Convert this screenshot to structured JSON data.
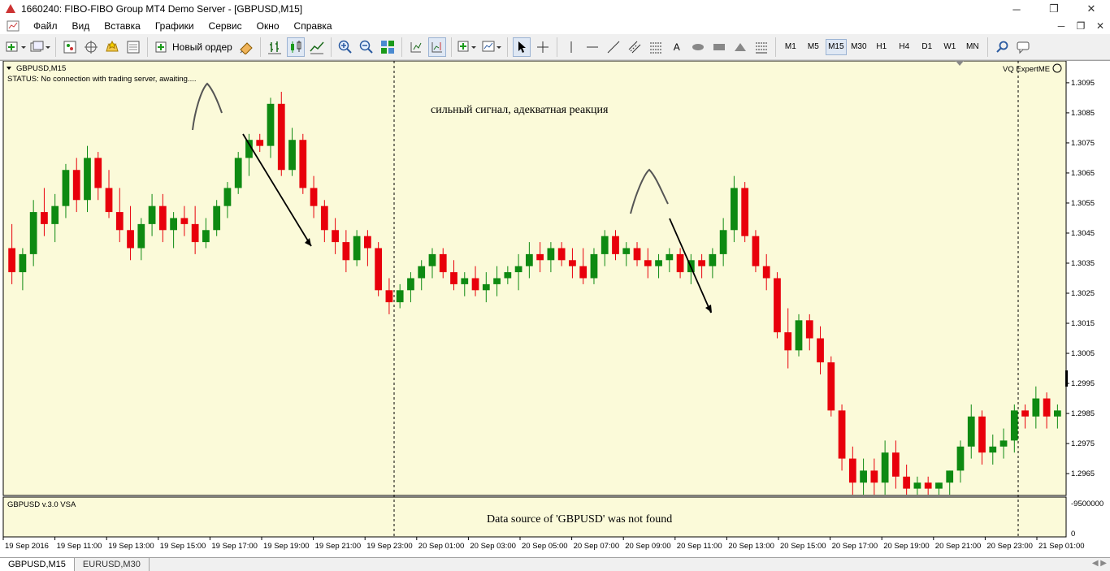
{
  "window": {
    "title": "1660240: FIBO-FIBO Group MT4 Demo Server - [GBPUSD,M15]",
    "minimize": "─",
    "restore": "❐",
    "close": "✕"
  },
  "menu": {
    "items": [
      "Файл",
      "Вид",
      "Вставка",
      "Графики",
      "Сервис",
      "Окно",
      "Справка"
    ],
    "right_controls": [
      "─",
      "❐",
      "✕"
    ]
  },
  "toolbar": {
    "new_order_label": "Новый ордер",
    "timeframes": [
      "M1",
      "M5",
      "M15",
      "M30",
      "H1",
      "H4",
      "D1",
      "W1",
      "MN"
    ],
    "active_timeframe": "M15",
    "text_tool_label": "A"
  },
  "chart": {
    "symbol_header": "GBPUSD,M15",
    "status_line": "STATUS:   No connection with trading server, awaiting....",
    "expert_label": "VQ ExpertME",
    "annotation_top": "сильный сигнал, адекватная реакция",
    "indicator_label": "GBPUSD v.3.0 VSA",
    "indicator_message": "Data source of 'GBPUSD' was not found",
    "indicator_scale_top": "-9500000",
    "indicator_scale_zero": "0",
    "colors": {
      "background": "#fbfad9",
      "bull": "#0e8a12",
      "bear": "#e8000b",
      "grid_line": "#000000",
      "axis_text": "#000000"
    }
  },
  "chart_data": {
    "type": "candlestick",
    "title": "GBPUSD,M15",
    "y_ticks": [
      "1.3095",
      "1.3085",
      "1.3075",
      "1.3065",
      "1.3055",
      "1.3045",
      "1.3035",
      "1.3025",
      "1.3015",
      "1.3005",
      "1.2995",
      "1.2985",
      "1.2975",
      "1.2965"
    ],
    "ylim": [
      1.2958,
      1.3102
    ],
    "x_ticks": [
      "19 Sep 2016",
      "19 Sep 11:00",
      "19 Sep 13:00",
      "19 Sep 15:00",
      "19 Sep 17:00",
      "19 Sep 19:00",
      "19 Sep 21:00",
      "19 Sep 23:00",
      "20 Sep 01:00",
      "20 Sep 03:00",
      "20 Sep 05:00",
      "20 Sep 07:00",
      "20 Sep 09:00",
      "20 Sep 11:00",
      "20 Sep 13:00",
      "20 Sep 15:00",
      "20 Sep 17:00",
      "20 Sep 19:00",
      "20 Sep 21:00",
      "20 Sep 23:00",
      "21 Sep 01:00"
    ],
    "candles": [
      [
        1.304,
        1.3048,
        1.3028,
        1.3032
      ],
      [
        1.3032,
        1.304,
        1.3026,
        1.3038
      ],
      [
        1.3038,
        1.3056,
        1.3034,
        1.3052
      ],
      [
        1.3052,
        1.306,
        1.3044,
        1.3048
      ],
      [
        1.3048,
        1.3058,
        1.3042,
        1.3054
      ],
      [
        1.3054,
        1.3068,
        1.305,
        1.3066
      ],
      [
        1.3066,
        1.307,
        1.3052,
        1.3056
      ],
      [
        1.3056,
        1.3074,
        1.3052,
        1.307
      ],
      [
        1.307,
        1.3072,
        1.3056,
        1.306
      ],
      [
        1.306,
        1.3066,
        1.305,
        1.3052
      ],
      [
        1.3052,
        1.306,
        1.3042,
        1.3046
      ],
      [
        1.3046,
        1.3054,
        1.3036,
        1.304
      ],
      [
        1.304,
        1.305,
        1.3036,
        1.3048
      ],
      [
        1.3048,
        1.3058,
        1.3044,
        1.3054
      ],
      [
        1.3054,
        1.3058,
        1.3042,
        1.3046
      ],
      [
        1.3046,
        1.3052,
        1.304,
        1.305
      ],
      [
        1.305,
        1.3054,
        1.3044,
        1.3048
      ],
      [
        1.3048,
        1.3054,
        1.3038,
        1.3042
      ],
      [
        1.3042,
        1.305,
        1.304,
        1.3046
      ],
      [
        1.3046,
        1.3056,
        1.3044,
        1.3054
      ],
      [
        1.3054,
        1.3062,
        1.305,
        1.306
      ],
      [
        1.306,
        1.3072,
        1.3058,
        1.307
      ],
      [
        1.307,
        1.3078,
        1.3064,
        1.3076
      ],
      [
        1.3076,
        1.3078,
        1.3072,
        1.3074
      ],
      [
        1.3074,
        1.309,
        1.307,
        1.3088
      ],
      [
        1.3088,
        1.3092,
        1.3064,
        1.3066
      ],
      [
        1.3066,
        1.308,
        1.3064,
        1.3076
      ],
      [
        1.3076,
        1.3078,
        1.3058,
        1.306
      ],
      [
        1.306,
        1.3064,
        1.305,
        1.3054
      ],
      [
        1.3054,
        1.3056,
        1.3042,
        1.3046
      ],
      [
        1.3046,
        1.305,
        1.3038,
        1.3042
      ],
      [
        1.3042,
        1.3046,
        1.3032,
        1.3036
      ],
      [
        1.3036,
        1.3046,
        1.3034,
        1.3044
      ],
      [
        1.3044,
        1.3046,
        1.3034,
        1.304
      ],
      [
        1.304,
        1.3042,
        1.3024,
        1.3026
      ],
      [
        1.3026,
        1.303,
        1.3018,
        1.3022
      ],
      [
        1.3022,
        1.3028,
        1.302,
        1.3026
      ],
      [
        1.3026,
        1.3032,
        1.3022,
        1.303
      ],
      [
        1.303,
        1.3036,
        1.3026,
        1.3034
      ],
      [
        1.3034,
        1.304,
        1.303,
        1.3038
      ],
      [
        1.3038,
        1.304,
        1.303,
        1.3032
      ],
      [
        1.3032,
        1.3036,
        1.3026,
        1.3028
      ],
      [
        1.3028,
        1.3032,
        1.3024,
        1.303
      ],
      [
        1.303,
        1.3034,
        1.3024,
        1.3026
      ],
      [
        1.3026,
        1.3032,
        1.3022,
        1.3028
      ],
      [
        1.3028,
        1.3034,
        1.3024,
        1.303
      ],
      [
        1.303,
        1.3034,
        1.3028,
        1.3032
      ],
      [
        1.3032,
        1.3038,
        1.3026,
        1.3034
      ],
      [
        1.3034,
        1.3042,
        1.303,
        1.3038
      ],
      [
        1.3038,
        1.3042,
        1.3032,
        1.3036
      ],
      [
        1.3036,
        1.3042,
        1.3032,
        1.304
      ],
      [
        1.304,
        1.3042,
        1.3034,
        1.3036
      ],
      [
        1.3036,
        1.304,
        1.303,
        1.3034
      ],
      [
        1.3034,
        1.304,
        1.3028,
        1.303
      ],
      [
        1.303,
        1.304,
        1.3028,
        1.3038
      ],
      [
        1.3038,
        1.3046,
        1.3034,
        1.3044
      ],
      [
        1.3044,
        1.3046,
        1.3036,
        1.3038
      ],
      [
        1.3038,
        1.3042,
        1.3034,
        1.304
      ],
      [
        1.304,
        1.3042,
        1.3034,
        1.3036
      ],
      [
        1.3036,
        1.304,
        1.303,
        1.3034
      ],
      [
        1.3034,
        1.3038,
        1.303,
        1.3036
      ],
      [
        1.3036,
        1.304,
        1.3032,
        1.3038
      ],
      [
        1.3038,
        1.304,
        1.303,
        1.3032
      ],
      [
        1.3032,
        1.3038,
        1.3028,
        1.3036
      ],
      [
        1.3036,
        1.3038,
        1.303,
        1.3034
      ],
      [
        1.3034,
        1.304,
        1.303,
        1.3038
      ],
      [
        1.3038,
        1.305,
        1.3034,
        1.3046
      ],
      [
        1.3046,
        1.3064,
        1.3042,
        1.306
      ],
      [
        1.306,
        1.3062,
        1.3042,
        1.3044
      ],
      [
        1.3044,
        1.3046,
        1.3032,
        1.3034
      ],
      [
        1.3034,
        1.3038,
        1.3026,
        1.303
      ],
      [
        1.303,
        1.3032,
        1.301,
        1.3012
      ],
      [
        1.3012,
        1.302,
        1.3,
        1.3006
      ],
      [
        1.3006,
        1.3018,
        1.3004,
        1.3016
      ],
      [
        1.3016,
        1.3018,
        1.3006,
        1.301
      ],
      [
        1.301,
        1.3014,
        1.2998,
        1.3002
      ],
      [
        1.3002,
        1.3004,
        1.2984,
        1.2986
      ],
      [
        1.2986,
        1.2988,
        1.2966,
        1.297
      ],
      [
        1.297,
        1.2974,
        1.2958,
        1.2962
      ],
      [
        1.2962,
        1.297,
        1.2958,
        1.2966
      ],
      [
        1.2966,
        1.297,
        1.2958,
        1.2962
      ],
      [
        1.2962,
        1.2976,
        1.2958,
        1.2972
      ],
      [
        1.2972,
        1.2976,
        1.296,
        1.2964
      ],
      [
        1.2964,
        1.2968,
        1.2958,
        1.296
      ],
      [
        1.296,
        1.2964,
        1.2958,
        1.2962
      ],
      [
        1.2962,
        1.2964,
        1.2958,
        1.296
      ],
      [
        1.296,
        1.2962,
        1.2958,
        1.2962
      ],
      [
        1.2962,
        1.2966,
        1.2958,
        1.2966
      ],
      [
        1.2966,
        1.2976,
        1.2962,
        1.2974
      ],
      [
        1.2974,
        1.2988,
        1.297,
        1.2984
      ],
      [
        1.2984,
        1.2986,
        1.2968,
        1.2972
      ],
      [
        1.2972,
        1.2978,
        1.2968,
        1.2974
      ],
      [
        1.2974,
        1.298,
        1.297,
        1.2976
      ],
      [
        1.2976,
        1.2988,
        1.2972,
        1.2986
      ],
      [
        1.2986,
        1.2988,
        1.298,
        1.2984
      ],
      [
        1.2984,
        1.2994,
        1.298,
        1.299
      ],
      [
        1.299,
        1.2992,
        1.298,
        1.2984
      ],
      [
        1.2984,
        1.2988,
        1.298,
        1.2986
      ]
    ]
  },
  "tabs": [
    "GBPUSD,M15",
    "EURUSD,M30"
  ],
  "tab_scroll": "◀ ▶"
}
